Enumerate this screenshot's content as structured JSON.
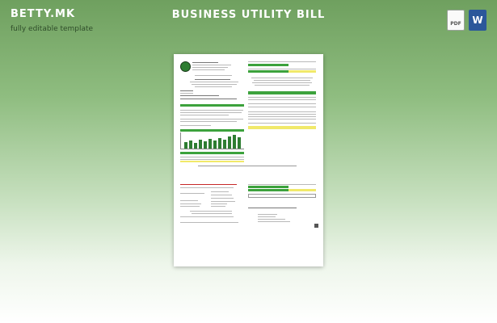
{
  "brand": {
    "logo": "BETTY.MK",
    "tagline": "fully editable template"
  },
  "title": "BUSINESS UTILITY BILL",
  "formats": [
    {
      "icon": "pdf-file-icon",
      "label": "PDF"
    },
    {
      "icon": "word-file-icon",
      "label": "W"
    }
  ],
  "colors": {
    "accent_green": "#3ca23c",
    "highlight_yellow": "#f1e96a",
    "word_blue": "#2b579a"
  }
}
